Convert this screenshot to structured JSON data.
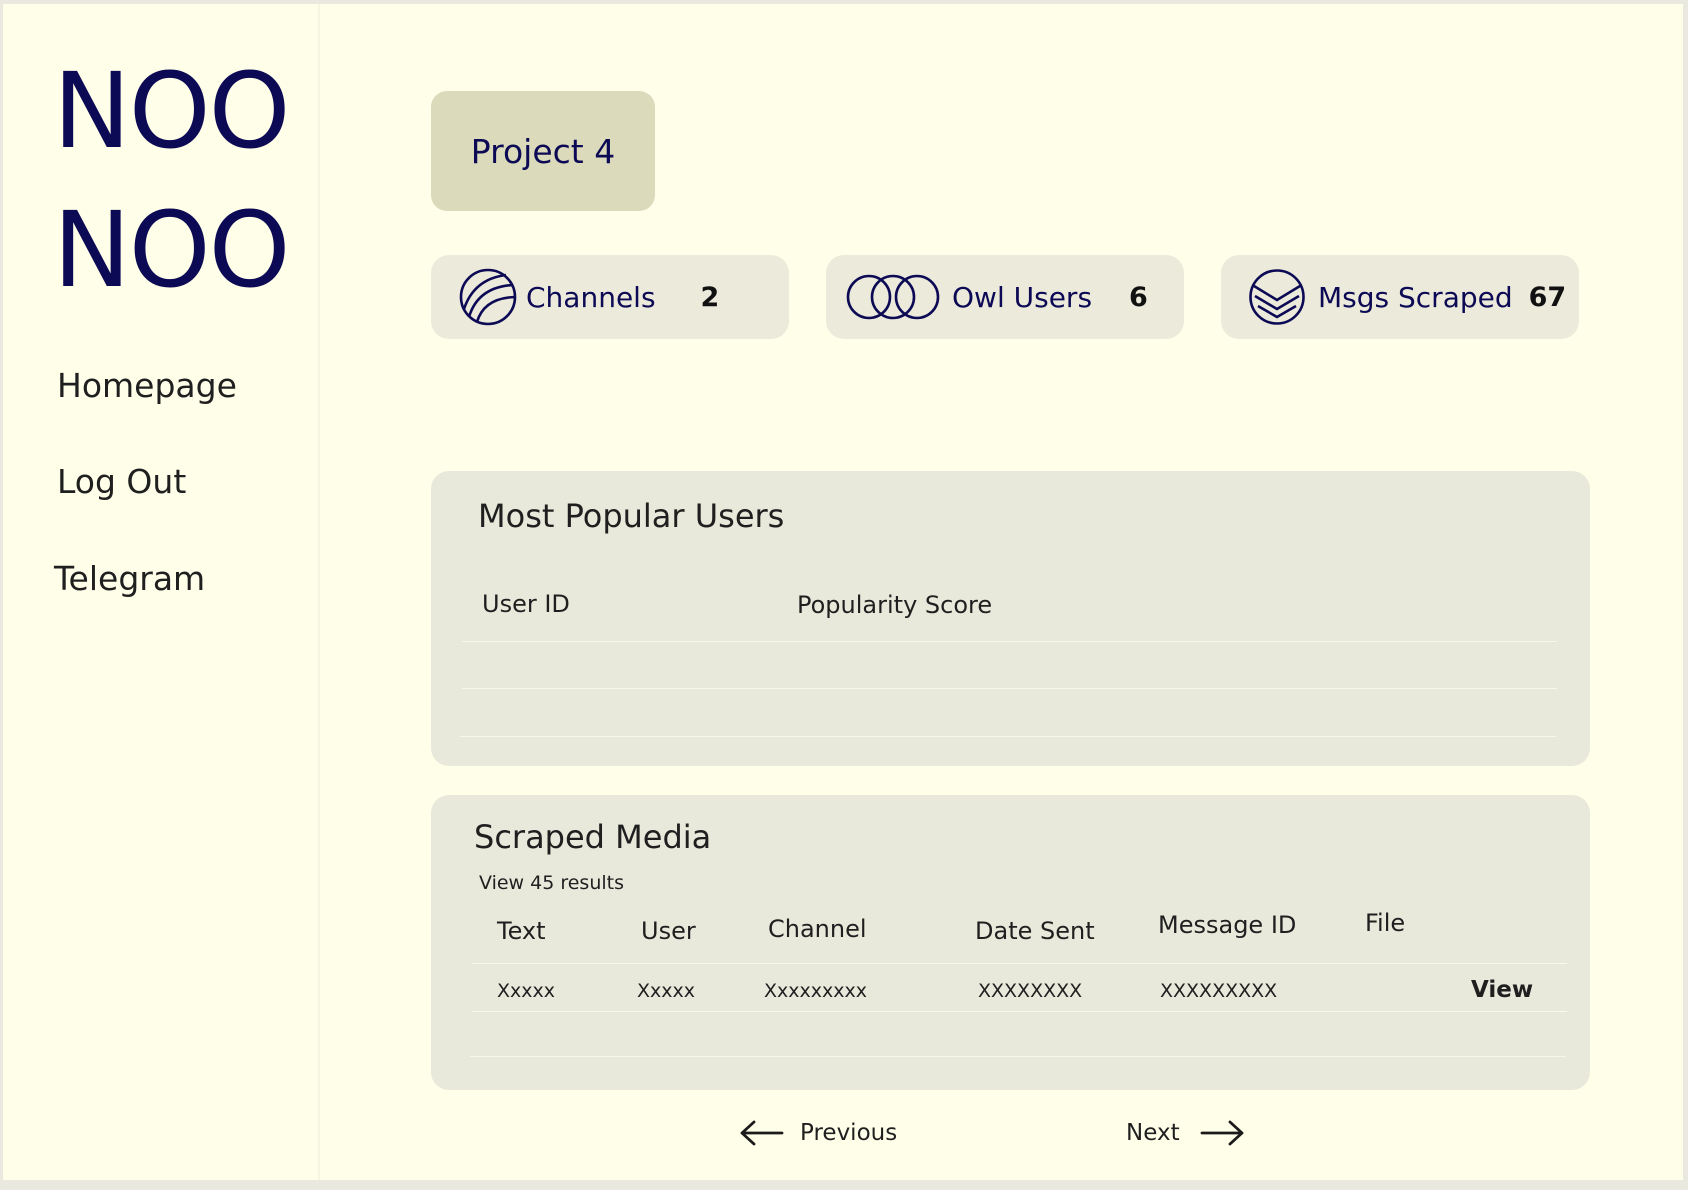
{
  "logo": {
    "line1": "NOO",
    "line2": "NOO"
  },
  "nav": {
    "homepage": "Homepage",
    "logout": "Log Out",
    "telegram": "Telegram"
  },
  "project": {
    "label": "Project 4"
  },
  "stats": {
    "channels": {
      "label": "Channels",
      "value": "2",
      "icon": "channels-icon"
    },
    "owl_users": {
      "label": "Owl Users",
      "value": "6",
      "icon": "rings-icon"
    },
    "msgs_scraped": {
      "label": "Msgs Scraped",
      "value": "67",
      "icon": "chevron-stack-icon"
    }
  },
  "popular_users": {
    "title": "Most Popular Users",
    "columns": [
      "User ID",
      "Popularity Score"
    ]
  },
  "scraped_media": {
    "title": "Scraped Media",
    "results_text": "View 45 results",
    "columns": [
      "Text",
      "User",
      "Channel",
      "Date Sent",
      "Message ID",
      "File"
    ],
    "rows": [
      {
        "text": "Xxxxx",
        "user": "Xxxxx",
        "channel": "Xxxxxxxxx",
        "date_sent": "XXXXXXXX",
        "message_id": "XXXXXXXXX",
        "action": "View"
      }
    ]
  },
  "pagination": {
    "previous": "Previous",
    "next": "Next"
  },
  "colors": {
    "brand": "#0d0a55",
    "background": "#fefee9",
    "panel": "#e8e8db",
    "badge": "#dbdabb"
  }
}
